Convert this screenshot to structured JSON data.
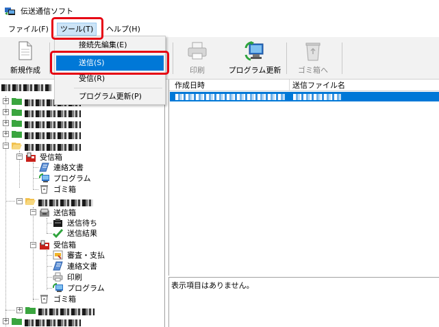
{
  "window": {
    "title": "伝送通信ソフト",
    "icon": "transfer-app-icon"
  },
  "menubar": {
    "items": [
      "ファイル(F)",
      "ツール(T)",
      "ヘルプ(H)"
    ]
  },
  "toolbar": {
    "buttons": [
      {
        "label": "新規作成",
        "icon": "new-document-icon",
        "enabled": true
      },
      {
        "label": "印刷",
        "icon": "printer-icon",
        "enabled": false
      },
      {
        "label": "プログラム更新",
        "icon": "program-update-icon",
        "enabled": true
      },
      {
        "label": "ゴミ箱へ",
        "icon": "recycle-bin-icon",
        "enabled": false
      }
    ]
  },
  "tools_menu": {
    "items": [
      {
        "label": "接続先編集(E)"
      },
      {
        "label": "送信(S)",
        "highlighted": true
      },
      {
        "label": "受信(R)"
      },
      {
        "label": "プログラム更新(P)"
      }
    ]
  },
  "tree": {
    "nodes": [
      {
        "label": "受信箱",
        "icon": "inbox-icon"
      },
      {
        "label": "連絡文書",
        "icon": "document-icon"
      },
      {
        "label": "プログラム",
        "icon": "program-icon"
      },
      {
        "label": "ゴミ箱",
        "icon": "trash-icon"
      },
      {
        "label": "送信箱",
        "icon": "outbox-icon"
      },
      {
        "label": "送信待ち",
        "icon": "pending-icon"
      },
      {
        "label": "送信結果",
        "icon": "checkmark-icon"
      },
      {
        "label": "受信箱",
        "icon": "inbox-icon"
      },
      {
        "label": "審査・支払",
        "icon": "review-icon"
      },
      {
        "label": "連絡文書",
        "icon": "document-icon"
      },
      {
        "label": "印刷",
        "icon": "printer-icon"
      },
      {
        "label": "プログラム",
        "icon": "program-icon"
      },
      {
        "label": "ゴミ箱",
        "icon": "trash-icon"
      }
    ]
  },
  "list": {
    "columns": [
      "作成日時",
      "送信ファイル名"
    ]
  },
  "detail": {
    "message": "表示項目はありません。"
  },
  "colors": {
    "selection": "#0078d7",
    "callout": "#e60012",
    "menu_hover": "#cce4f7"
  }
}
